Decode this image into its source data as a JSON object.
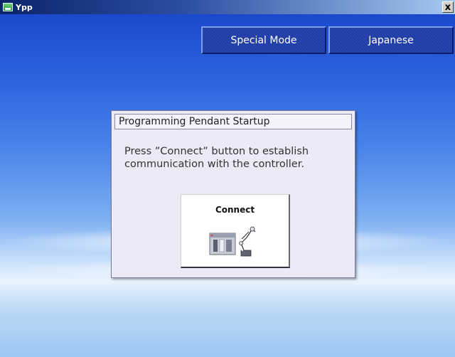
{
  "window": {
    "title": "Ypp",
    "close_glyph": "x"
  },
  "toolbar": {
    "special_mode_label": "Special Mode",
    "japanese_label": "Japanese"
  },
  "dialog": {
    "title": "Programming Pendant Startup",
    "message": "Press ”Connect” button to establish\ncommunication with the controller.",
    "connect_label": "Connect",
    "connect_icon": "controller-robot-icon"
  },
  "colors": {
    "titlebar_start": "#0a246a",
    "button_blue": "#1f3da8",
    "dialog_bg": "#eceaf6"
  }
}
